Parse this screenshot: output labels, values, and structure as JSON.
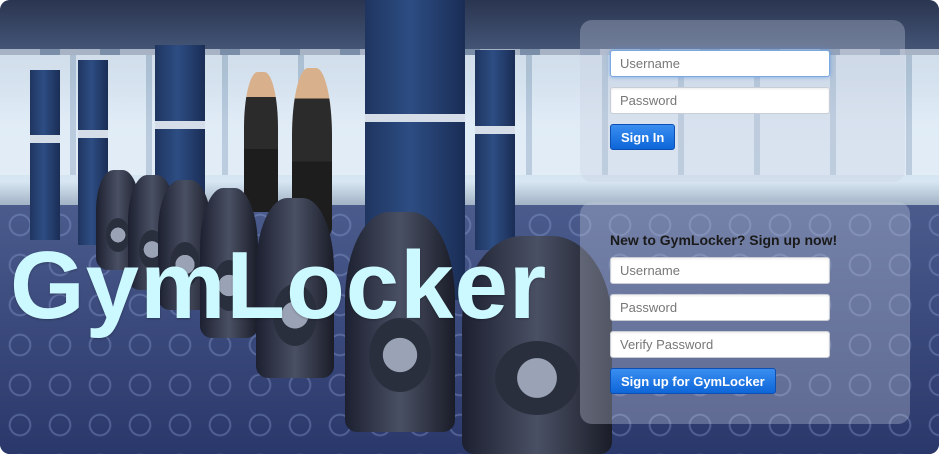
{
  "brand": {
    "name": "GymLocker"
  },
  "login": {
    "username_placeholder": "Username",
    "password_placeholder": "Password",
    "submit_label": "Sign In"
  },
  "signup": {
    "heading": "New to GymLocker? Sign up now!",
    "username_placeholder": "Username",
    "password_placeholder": "Password",
    "verify_placeholder": "Verify Password",
    "submit_label": "Sign up for GymLocker"
  },
  "colors": {
    "brand_text": "#ccf9ff",
    "button_primary": "#0d66d9",
    "panel_overlay": "rgba(200,205,225,.33)"
  }
}
